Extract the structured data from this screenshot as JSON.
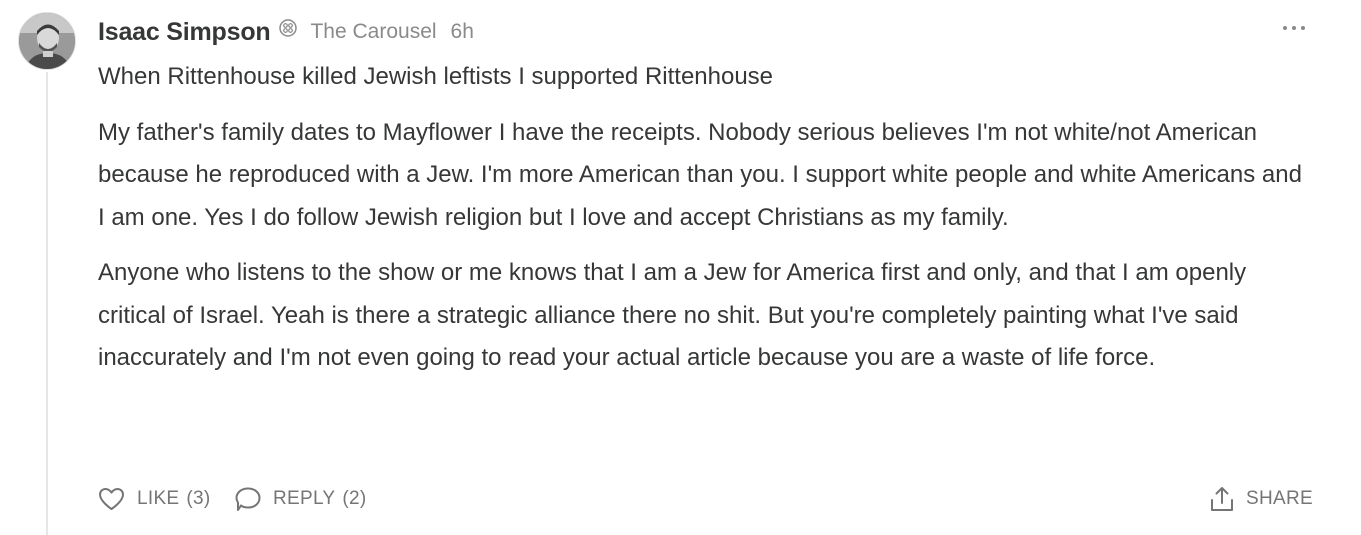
{
  "comment": {
    "author": "Isaac Simpson",
    "publication": "The Carousel",
    "time": "6h",
    "paragraphs": [
      "When Rittenhouse killed Jewish leftists I supported Rittenhouse",
      "My father's family dates to Mayflower I have the receipts. Nobody serious believes I'm not white/not American because he reproduced with a Jew. I'm more American than you. I support white people and white Americans and I am one. Yes I do follow Jewish religion but I love and accept Christians as my family.",
      "Anyone who listens to the show or me knows that I am a Jew for America first and only, and that I am openly critical of Israel. Yeah is there a strategic alliance there no shit. But you're completely painting what I've said inaccurately and I'm not even going to read your actual article because you are a waste of life force."
    ]
  },
  "actions": {
    "like_label": "LIKE",
    "like_count": "(3)",
    "reply_label": "REPLY",
    "reply_count": "(2)",
    "share_label": "SHARE"
  },
  "icons": {
    "avatar": "avatar-photo",
    "badge": "publication-badge-icon",
    "more": "ellipsis-icon",
    "like": "heart-icon",
    "reply": "speech-bubble-icon",
    "share": "share-icon"
  },
  "colors": {
    "text": "#363737",
    "muted": "#8a8a8a",
    "action": "#757575",
    "thread_line": "#e6e6e6"
  }
}
